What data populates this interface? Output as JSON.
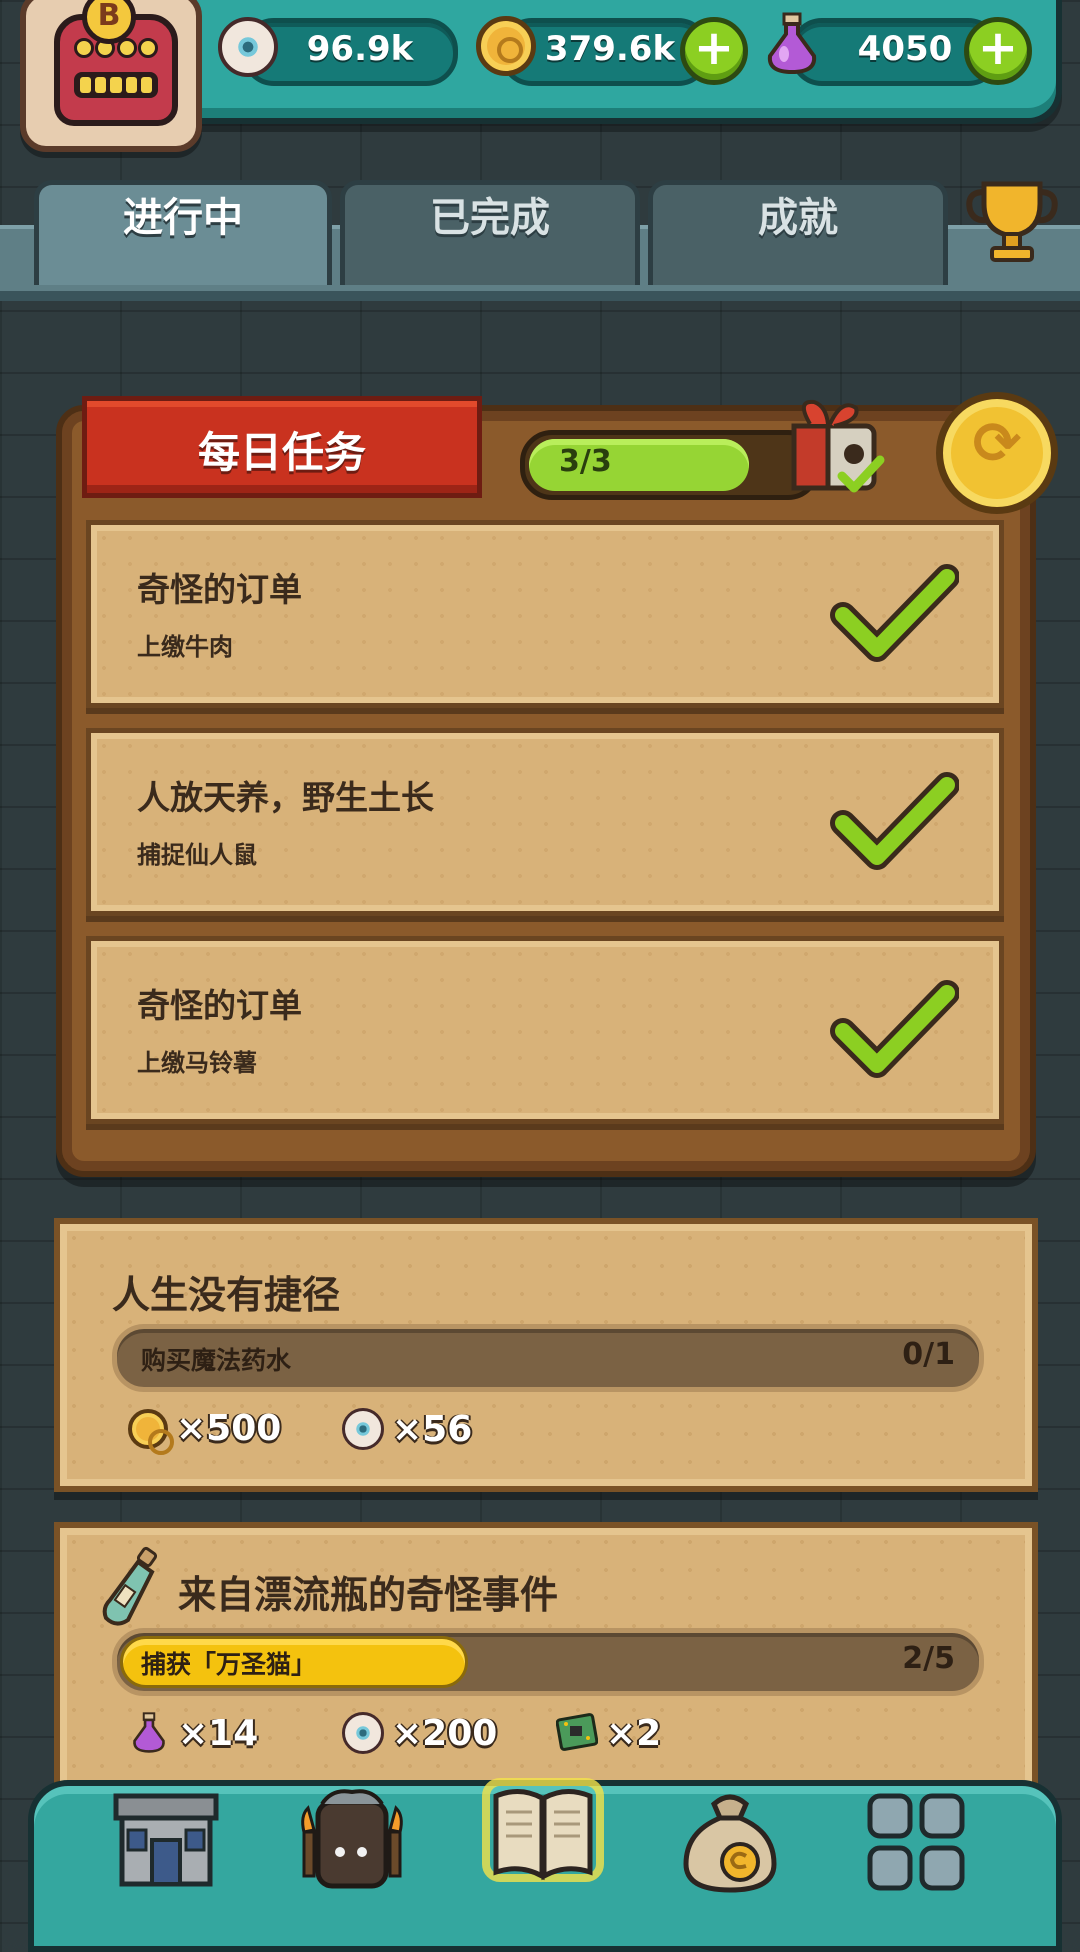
{
  "currency": {
    "eyeballs": "96.9k",
    "coins": "379.6k",
    "potions": "4050",
    "avatar_badge": "B"
  },
  "tabs": [
    {
      "label": "进行中",
      "active": true
    },
    {
      "label": "已完成",
      "active": false
    },
    {
      "label": "成就",
      "active": false
    }
  ],
  "daily": {
    "banner": "每日任务",
    "progress_text": "3/3",
    "progress": 1.0,
    "tasks": [
      {
        "title": "奇怪的订单",
        "subtitle": "上缴牛肉"
      },
      {
        "title": "人放天养，野生土长",
        "subtitle": "捕捉仙人鼠"
      },
      {
        "title": "奇怪的订单",
        "subtitle": "上缴马铃薯"
      }
    ]
  },
  "quests": [
    {
      "title": "人生没有捷径",
      "task": "购买魔法药水",
      "count": "0/1",
      "progress": 0.0,
      "rewards": [
        {
          "icon": "coin-icon",
          "value": "×500"
        },
        {
          "icon": "eyeball-icon",
          "value": "×56"
        }
      ]
    },
    {
      "title": "来自漂流瓶的奇怪事件",
      "task": "捕获「万圣猫」",
      "count": "2/5",
      "progress": 0.4,
      "rewards": [
        {
          "icon": "potion-icon",
          "value": "×14"
        },
        {
          "icon": "eyeball-icon",
          "value": "×200"
        },
        {
          "icon": "circuit-card-icon",
          "value": "×2"
        }
      ]
    }
  ],
  "nav": [
    "shop-building-icon",
    "furnace-monster-icon",
    "quest-book-icon",
    "money-bag-icon",
    "grid-menu-icon"
  ],
  "colors": {
    "accent_green": "#8ccf22",
    "progress_yellow": "#f4c20e",
    "banner_red": "#c9321f",
    "teal": "#2fa7a0"
  }
}
